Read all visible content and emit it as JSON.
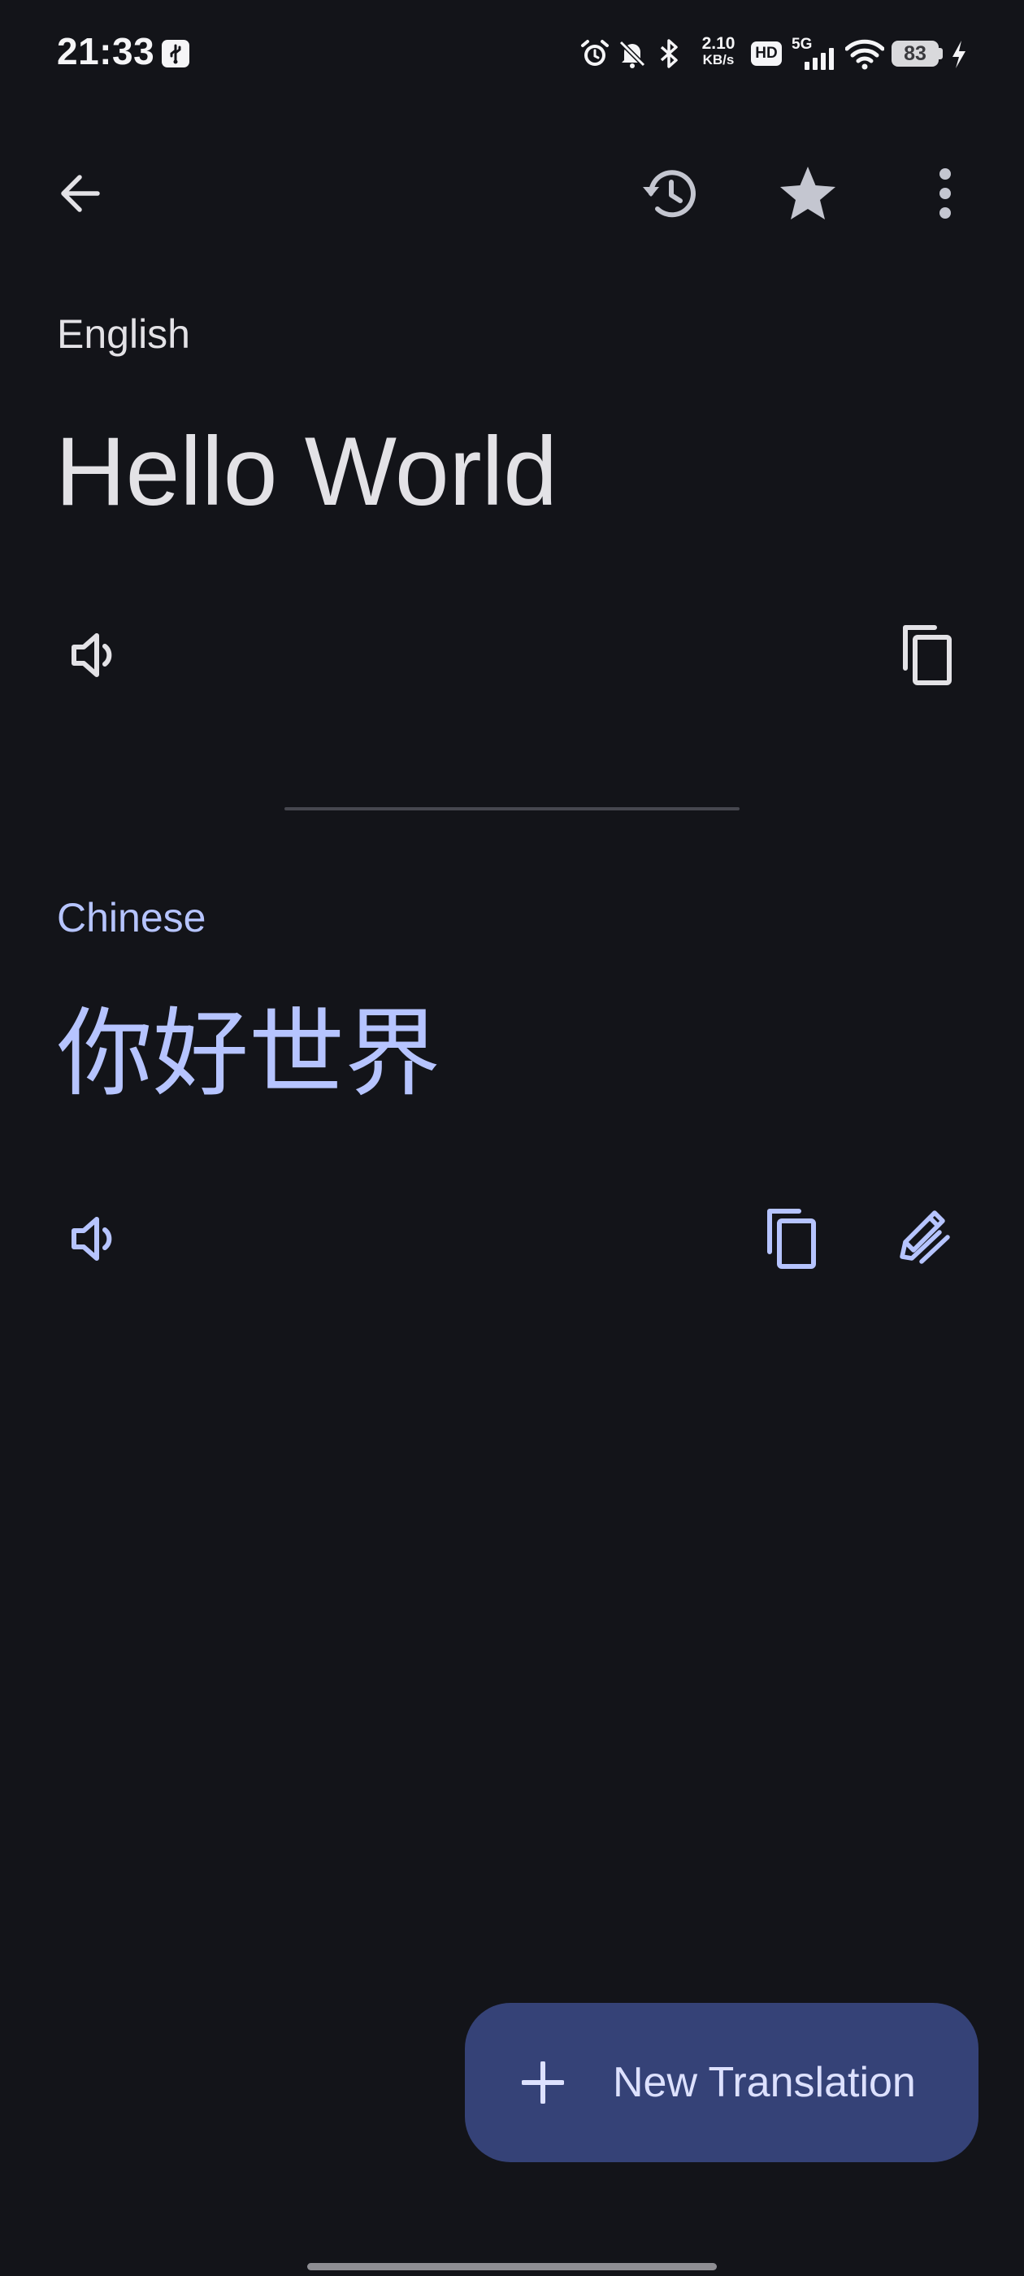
{
  "status_bar": {
    "time": "21:33",
    "net_speed_value": "2.10",
    "net_speed_unit": "KB/s",
    "hd_label": "HD",
    "signal_label": "5G",
    "battery_level": "83"
  },
  "toolbar": {
    "back_icon": "arrow-back-icon",
    "history_icon": "history-icon",
    "favorite_icon": "star-icon",
    "more_icon": "more-vert-icon"
  },
  "source": {
    "language": "English",
    "text": "Hello World"
  },
  "target": {
    "language": "Chinese",
    "text": "你好世界"
  },
  "fab": {
    "label": "New Translation"
  },
  "colors": {
    "background": "#131419",
    "source_text": "#e3e2e6",
    "target_accent": "#b6c4ff",
    "fab_background": "#354277"
  }
}
